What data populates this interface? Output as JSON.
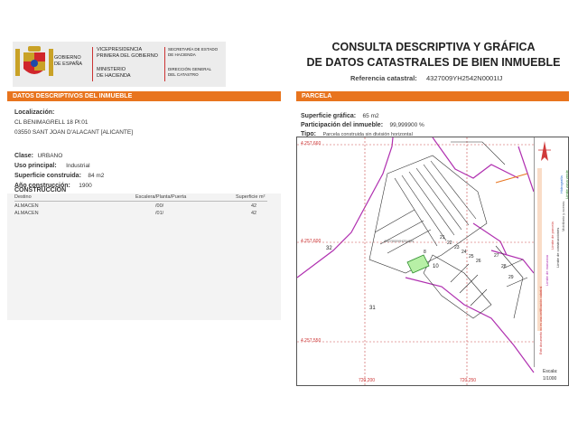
{
  "header": {
    "gobierno": [
      "GOBIERNO",
      "DE ESPAÑA"
    ],
    "vicepresidencia": [
      "VICEPRESIDENCIA",
      "PRIMERA DEL GOBIERNO"
    ],
    "ministerio": [
      "MINISTERIO",
      "DE HACIENDA"
    ],
    "secretaria": [
      "SECRETARÍA DE ESTADO",
      "DE HACIENDA"
    ],
    "direccion": [
      "DIRECCIÓN GENERAL",
      "DEL CATASTRO"
    ],
    "title_line1": "CONSULTA DESCRIPTIVA Y GRÁFICA",
    "title_line2": "DE DATOS CATASTRALES DE BIEN INMUEBLE",
    "ref_label": "Referencia catastral:",
    "ref_value": "4327009YH2542N0001IJ"
  },
  "left": {
    "bar_title": "DATOS DESCRIPTIVOS DEL INMUEBLE",
    "localizacion_label": "Localización:",
    "address1": "CL BENIMAGRELL 18 Pl:01",
    "address2": "03550 SANT JOAN D'ALACANT [ALICANTE]",
    "clase_label": "Clase:",
    "clase_value": "URBANO",
    "uso_label": "Uso principal:",
    "uso_value": "Industrial",
    "sup_label": "Superficie construida:",
    "sup_value": "84 m2",
    "anio_label": "Año construcción:",
    "anio_value": "1900",
    "construccion_title": "CONSTRUCCIÓN",
    "table_headers": [
      "Destino",
      "Escalera/Planta/Puerta",
      "Superficie m²"
    ],
    "rows": [
      [
        "ALMACEN",
        "/00/",
        "42"
      ],
      [
        "ALMACEN",
        "/01/",
        "42"
      ]
    ]
  },
  "right": {
    "bar_title": "PARCELA",
    "sup_label": "Superficie gráfica:",
    "sup_value": "65 m2",
    "part_label": "Participación del inmueble:",
    "part_value": "99,999900 %",
    "tipo_label": "Tipo:",
    "tipo_value": "Parcela construida sin división horizontal"
  },
  "map": {
    "coords": {
      "y_top": "4.257.660",
      "y_mid": "4.257.600",
      "y_low": "4.257.550",
      "x_left": "720,200",
      "x_right": "720,250"
    },
    "parcel_numbers": [
      "32",
      "31",
      "10",
      "8",
      "21",
      "22",
      "23",
      "24",
      "25",
      "26",
      "27",
      "28",
      "29"
    ],
    "parcel_text": "4327009YH2542N",
    "escala_label": "Escala:",
    "escala_value": "1/1000",
    "legend": [
      "Límite de manzana",
      "Límite de parcela",
      "Límite de construcciones",
      "Mobiliario y aceras",
      "Límite zona verde",
      "Hidrografía"
    ],
    "legend_colors": [
      "#b030b0",
      "#d04040",
      "#333333",
      "#888888",
      "#2a8a2a",
      "#2a6fd0"
    ],
    "side_caption": "Este documento no es una certificación catastral",
    "colors": {
      "orange": "#e8741e",
      "purple": "#b030b0",
      "parcel_fill": "#b7f0a6"
    }
  }
}
